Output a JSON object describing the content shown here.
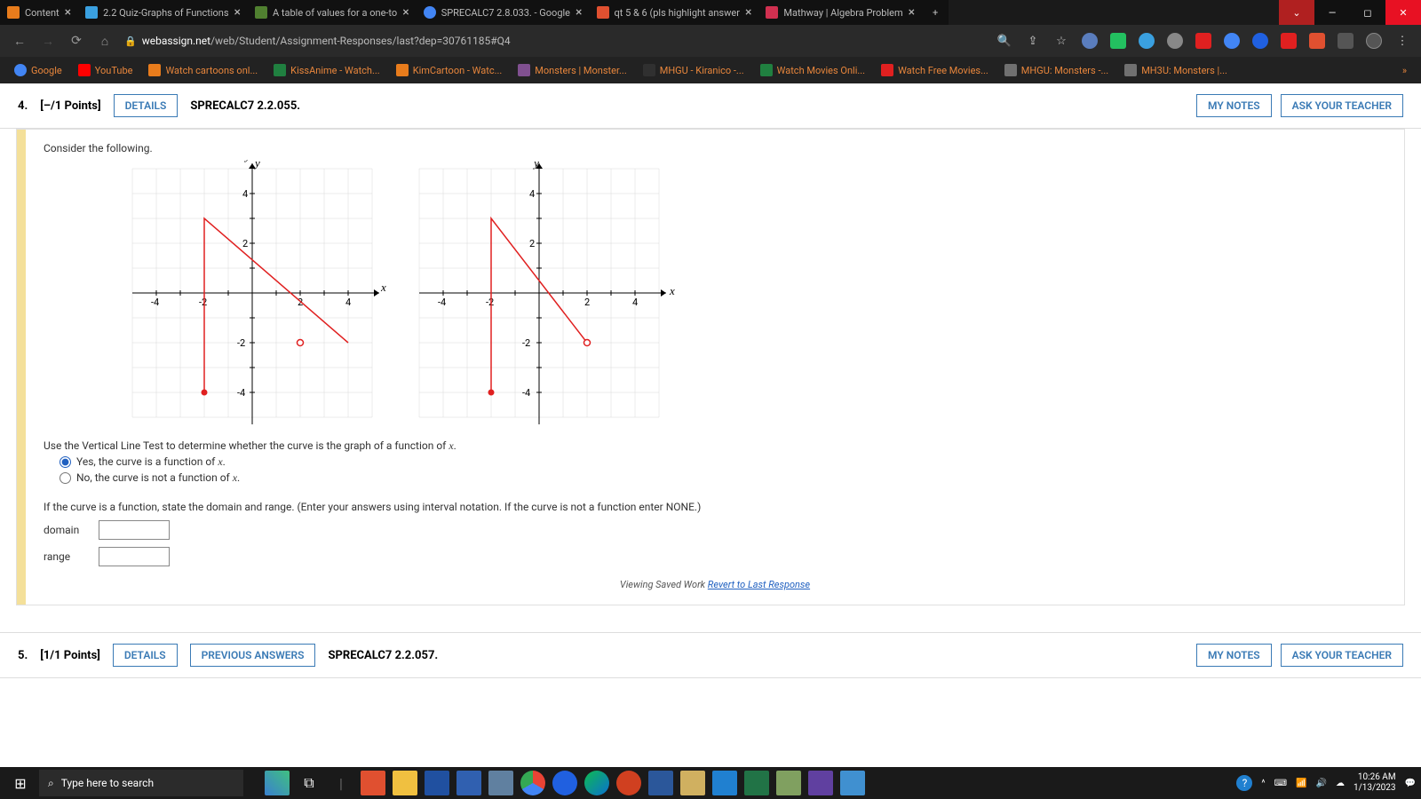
{
  "titlebar": {
    "tabs": [
      {
        "label": "Content",
        "color": "#e87c1c"
      },
      {
        "label": "2.2 Quiz-Graphs of Functions",
        "color": "#3aa0e0"
      },
      {
        "label": "A table of values for a one-to",
        "color": "#508030"
      },
      {
        "label": "SPRECALC7 2.8.033. - Google",
        "color": "#4285f4"
      },
      {
        "label": "qt 5 & 6 (pls highlight answer",
        "color": "#e05030"
      },
      {
        "label": "Mathway | Algebra Problem",
        "color": "#d03050"
      }
    ],
    "win": {
      "down": "⌄",
      "min": "—",
      "max": "◻",
      "close": "✕"
    }
  },
  "addr": {
    "url_host": "webassign.net",
    "url_path": "/web/Student/Assignment-Responses/last?dep=30761185#Q4"
  },
  "bookmarks": [
    {
      "label": "Google",
      "color": "#4285f4"
    },
    {
      "label": "YouTube",
      "color": "#ff0000"
    },
    {
      "label": "Watch cartoons onl...",
      "color": "#e87c1c"
    },
    {
      "label": "KissAnime - Watch...",
      "color": "#208040"
    },
    {
      "label": "KimCartoon - Watc...",
      "color": "#e87c1c"
    },
    {
      "label": "Monsters | Monster...",
      "color": "#805090"
    },
    {
      "label": "MHGU - Kiranico -...",
      "color": "#303030"
    },
    {
      "label": "Watch Movies Onli...",
      "color": "#208040"
    },
    {
      "label": "Watch Free Movies...",
      "color": "#e02020"
    },
    {
      "label": "MHGU: Monsters -...",
      "color": "#707070"
    },
    {
      "label": "MH3U: Monsters |...",
      "color": "#707070"
    }
  ],
  "q4": {
    "num": "4.",
    "pts": "[–/1 Points]",
    "details": "DETAILS",
    "ref": "SPRECALC7 2.2.055.",
    "mynotes": "MY NOTES",
    "ask": "ASK YOUR TEACHER",
    "prompt": "Consider the following.",
    "instr": "Use the Vertical Line Test to determine whether the curve is the graph of a function of ",
    "var": "x",
    "opt1": "Yes, the curve is a function of ",
    "opt2": "No, the curve is not a function of ",
    "domrange": "If the curve is a function, state the domain and range. (Enter your answers using interval notation. If the curve is not a function enter NONE.)",
    "domlabel": "domain",
    "rangelabel": "range",
    "saved_prefix": "Viewing Saved Work ",
    "saved_link": "Revert to Last Response"
  },
  "q5": {
    "num": "5.",
    "pts": "[1/1 Points]",
    "details": "DETAILS",
    "prev": "PREVIOUS ANSWERS",
    "ref": "SPRECALC7 2.2.057.",
    "mynotes": "MY NOTES",
    "ask": "ASK YOUR TEACHER"
  },
  "chart_data": {
    "type": "line",
    "xlabel": "x",
    "ylabel": "y",
    "xlim": [
      -5,
      5
    ],
    "ylim": [
      -5,
      5
    ],
    "xticks": [
      -4,
      -2,
      2,
      4
    ],
    "yticks": [
      -4,
      -2,
      2,
      4
    ],
    "series": [
      {
        "name": "curve",
        "x": [
          -2,
          -2,
          2
        ],
        "y": [
          -4,
          3,
          -2
        ]
      }
    ],
    "endpoints": [
      {
        "x": -2,
        "y": -4,
        "open": false
      },
      {
        "x": 2,
        "y": -2,
        "open": true
      }
    ]
  },
  "taskbar": {
    "search_placeholder": "Type here to search",
    "time": "10:26 AM",
    "date": "1/13/2023"
  }
}
